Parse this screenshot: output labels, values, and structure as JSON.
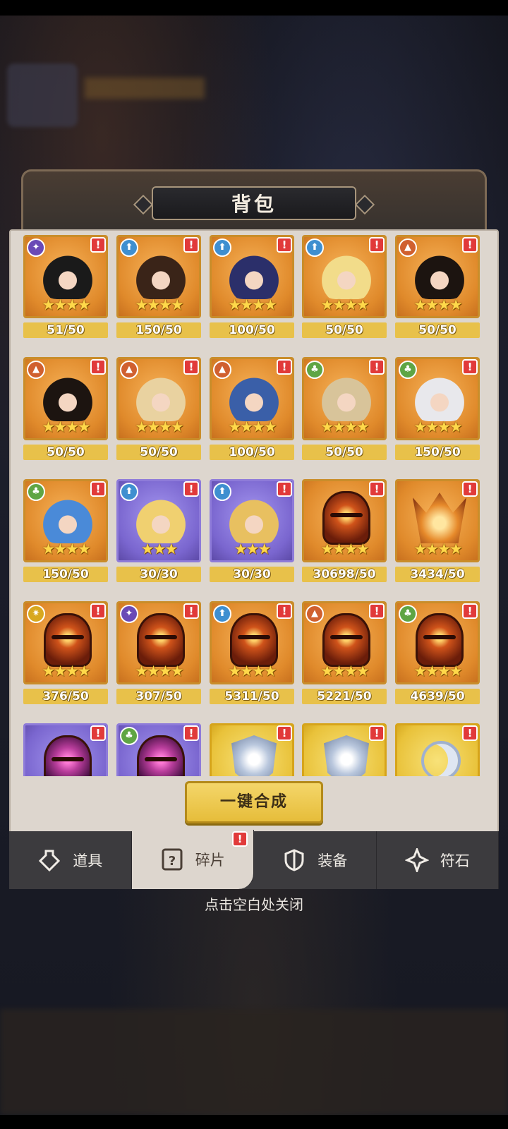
{
  "title": "背包",
  "action_button": "一键合成",
  "close_hint": "点击空白处关闭",
  "tabs": [
    {
      "label": "道具",
      "icon": "potion-icon",
      "active": false
    },
    {
      "label": "碎片",
      "icon": "fragment-icon",
      "active": true,
      "alert": "!"
    },
    {
      "label": "装备",
      "icon": "shield-icon",
      "active": false
    },
    {
      "label": "符石",
      "icon": "rune-icon",
      "active": false
    }
  ],
  "items": [
    {
      "count": "51/50",
      "kind": "hero",
      "frame": "orange",
      "faction": "purple",
      "stars": 4,
      "hair": "#1a1a1a"
    },
    {
      "count": "150/50",
      "kind": "hero",
      "frame": "orange",
      "faction": "blue",
      "stars": 4,
      "hair": "#3a2418"
    },
    {
      "count": "100/50",
      "kind": "hero",
      "frame": "orange",
      "faction": "blue",
      "stars": 4,
      "hair": "#2b2f6a"
    },
    {
      "count": "50/50",
      "kind": "hero",
      "frame": "orange",
      "faction": "blue",
      "stars": 4,
      "hair": "#f2dc8a"
    },
    {
      "count": "50/50",
      "kind": "hero",
      "frame": "orange",
      "faction": "red",
      "stars": 4,
      "hair": "#1c1410"
    },
    {
      "count": "50/50",
      "kind": "hero",
      "frame": "orange",
      "faction": "red",
      "stars": 4,
      "hair": "#1c1410"
    },
    {
      "count": "50/50",
      "kind": "hero",
      "frame": "orange",
      "faction": "red",
      "stars": 4,
      "hair": "#e9d2a0"
    },
    {
      "count": "100/50",
      "kind": "hero",
      "frame": "orange",
      "faction": "red",
      "stars": 4,
      "hair": "#3a5fa8"
    },
    {
      "count": "50/50",
      "kind": "hero",
      "frame": "orange",
      "faction": "green",
      "stars": 4,
      "hair": "#d8c49a"
    },
    {
      "count": "150/50",
      "kind": "hero",
      "frame": "orange",
      "faction": "green",
      "stars": 4,
      "hair": "#e8e8ec"
    },
    {
      "count": "150/50",
      "kind": "hero",
      "frame": "orange",
      "faction": "green",
      "stars": 4,
      "hair": "#4a8ad8"
    },
    {
      "count": "30/30",
      "kind": "hero",
      "frame": "purple",
      "faction": "blue",
      "stars": 3,
      "hair": "#f0d070"
    },
    {
      "count": "30/30",
      "kind": "hero",
      "frame": "purple",
      "faction": "blue",
      "stars": 3,
      "hair": "#e8c060"
    },
    {
      "count": "30698/50",
      "kind": "helmet",
      "frame": "orange",
      "faction": "",
      "stars": 4
    },
    {
      "count": "3434/50",
      "kind": "crown",
      "frame": "orange",
      "faction": "",
      "stars": 4
    },
    {
      "count": "376/50",
      "kind": "helmet",
      "frame": "orange",
      "faction": "yellow",
      "stars": 4
    },
    {
      "count": "307/50",
      "kind": "helmet",
      "frame": "orange",
      "faction": "purple",
      "stars": 4
    },
    {
      "count": "5311/50",
      "kind": "helmet",
      "frame": "orange",
      "faction": "blue",
      "stars": 4
    },
    {
      "count": "5221/50",
      "kind": "helmet",
      "frame": "orange",
      "faction": "red",
      "stars": 4
    },
    {
      "count": "4639/50",
      "kind": "helmet",
      "frame": "orange",
      "faction": "green",
      "stars": 4
    },
    {
      "count": "",
      "kind": "helmet-pink",
      "frame": "purple",
      "faction": "",
      "stars": 0
    },
    {
      "count": "",
      "kind": "helmet-pink",
      "frame": "purple",
      "faction": "green",
      "stars": 0
    },
    {
      "count": "",
      "kind": "shield",
      "frame": "gold",
      "faction": "",
      "stars": 0
    },
    {
      "count": "",
      "kind": "shield",
      "frame": "gold",
      "faction": "",
      "stars": 0
    },
    {
      "count": "",
      "kind": "moon",
      "frame": "gold",
      "faction": "",
      "stars": 0
    }
  ],
  "colors": {
    "panel": "#ddd6ce",
    "count_bar": "#e8c14a",
    "alert": "#e13a3a",
    "tab_bar": "#3c3b3e"
  }
}
